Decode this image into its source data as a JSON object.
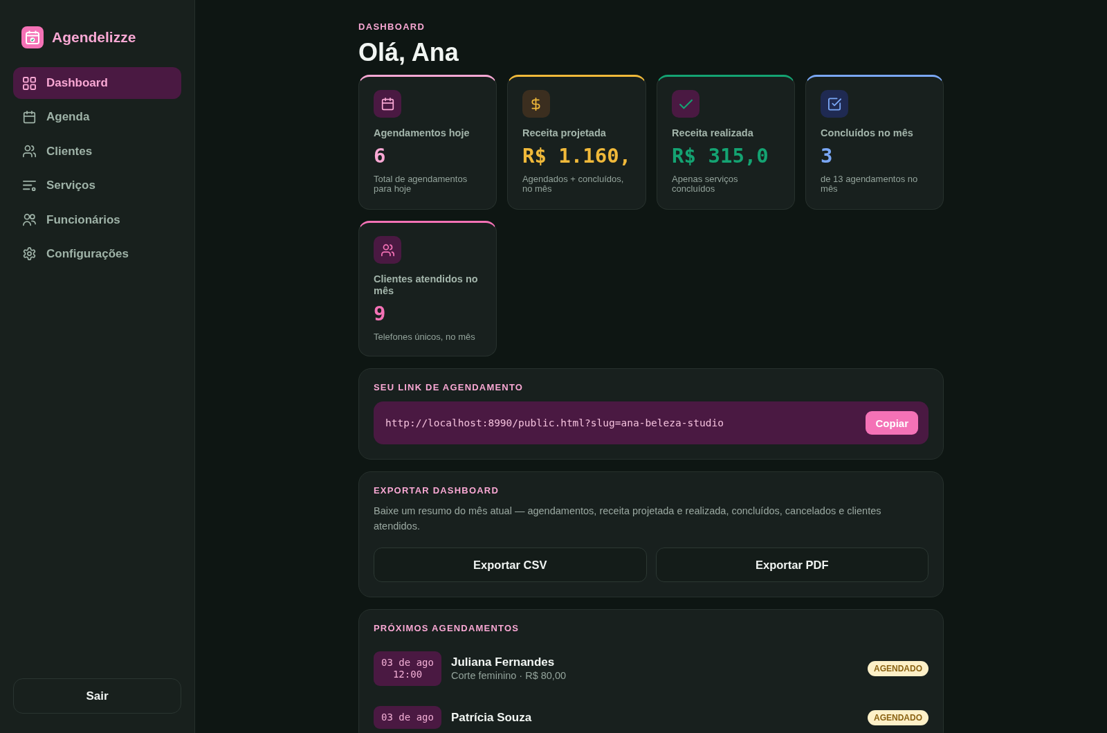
{
  "sidebar": {
    "brand": "Agendelizze",
    "items": [
      {
        "label": "Dashboard",
        "selected": true
      },
      {
        "label": "Agenda",
        "selected": false
      },
      {
        "label": "Clientes",
        "selected": false
      },
      {
        "label": "Serviços",
        "selected": false
      },
      {
        "label": "Funcionários",
        "selected": false
      },
      {
        "label": "Configurações",
        "selected": false
      }
    ],
    "logout": "Sair"
  },
  "header": {
    "eyebrow": "DASHBOARD",
    "title": "Olá, Ana"
  },
  "stats": [
    {
      "label": "Agendamentos hoje",
      "value": "6",
      "note": "Total de agendamentos para hoje",
      "color": "#f9a8d4"
    },
    {
      "label": "Receita projetada",
      "value": "R$ 1.160,",
      "note": "Agendados + concluídos, no mês",
      "color": "#f0b93a"
    },
    {
      "label": "Receita realizada",
      "value": "R$ 315,0",
      "note": "Apenas serviços concluídos",
      "color": "#14a372"
    },
    {
      "label": "Concluídos no mês",
      "value": "3",
      "note": "de 13 agendamentos no mês",
      "color": "#7aa7f5"
    },
    {
      "label": "Clientes atendidos no mês",
      "value": "9",
      "note": "Telefones únicos, no mês",
      "color": "#f472b6"
    }
  ],
  "link_section": {
    "title": "SEU LINK DE AGENDAMENTO",
    "url": "http://localhost:8990/public.html?slug=ana-beleza-studio",
    "button": "Copiar"
  },
  "export_section": {
    "title": "EXPORTAR DASHBOARD",
    "description": "Baixe um resumo do mês atual — agendamentos, receita projetada e realizada, concluídos, cancelados e clientes atendidos.",
    "buttons": [
      "Exportar CSV",
      "Exportar PDF"
    ]
  },
  "upcoming": {
    "title": "PRÓXIMOS AGENDAMENTOS",
    "items": [
      {
        "date": "03 de ago",
        "time": "12:00",
        "name": "Juliana Fernandes",
        "service": "Corte feminino · R$ 80,00",
        "status": "AGENDADO"
      },
      {
        "date": "03 de ago",
        "name": "Patrícia Souza",
        "status": "AGENDADO"
      }
    ]
  }
}
